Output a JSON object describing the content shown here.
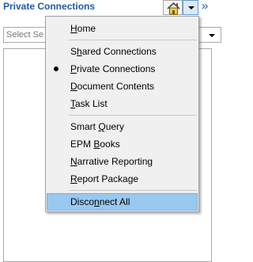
{
  "header": {
    "title": "Private Connections",
    "home_icon": "home-icon",
    "dropdown_icon": "caret-down-icon",
    "collapse_icon": "double-chevron-right-icon",
    "collapse_glyph": "»"
  },
  "search": {
    "placeholder": "Select Se"
  },
  "menu": {
    "items": [
      {
        "pre": "",
        "u": "H",
        "post": "ome"
      },
      {
        "pre": "S",
        "u": "h",
        "post": "ared Connections"
      },
      {
        "pre": "",
        "u": "P",
        "post": "rivate Connections",
        "checked": true
      },
      {
        "pre": "",
        "u": "D",
        "post": "ocument Contents"
      },
      {
        "pre": "",
        "u": "T",
        "post": "ask List"
      },
      {
        "pre": "Smart ",
        "u": "Q",
        "post": "uery"
      },
      {
        "pre": "EPM ",
        "u": "B",
        "post": "ooks"
      },
      {
        "pre": "",
        "u": "N",
        "post": "arrative Reporting"
      },
      {
        "pre": "",
        "u": "R",
        "post": "eport Package"
      },
      {
        "pre": "Disco",
        "u": "n",
        "post": "nect All",
        "highlighted": true
      }
    ]
  },
  "colors": {
    "title": "#1f5aa6",
    "highlight": "#99c8f0",
    "menu_bg": "#f0f0f0"
  }
}
